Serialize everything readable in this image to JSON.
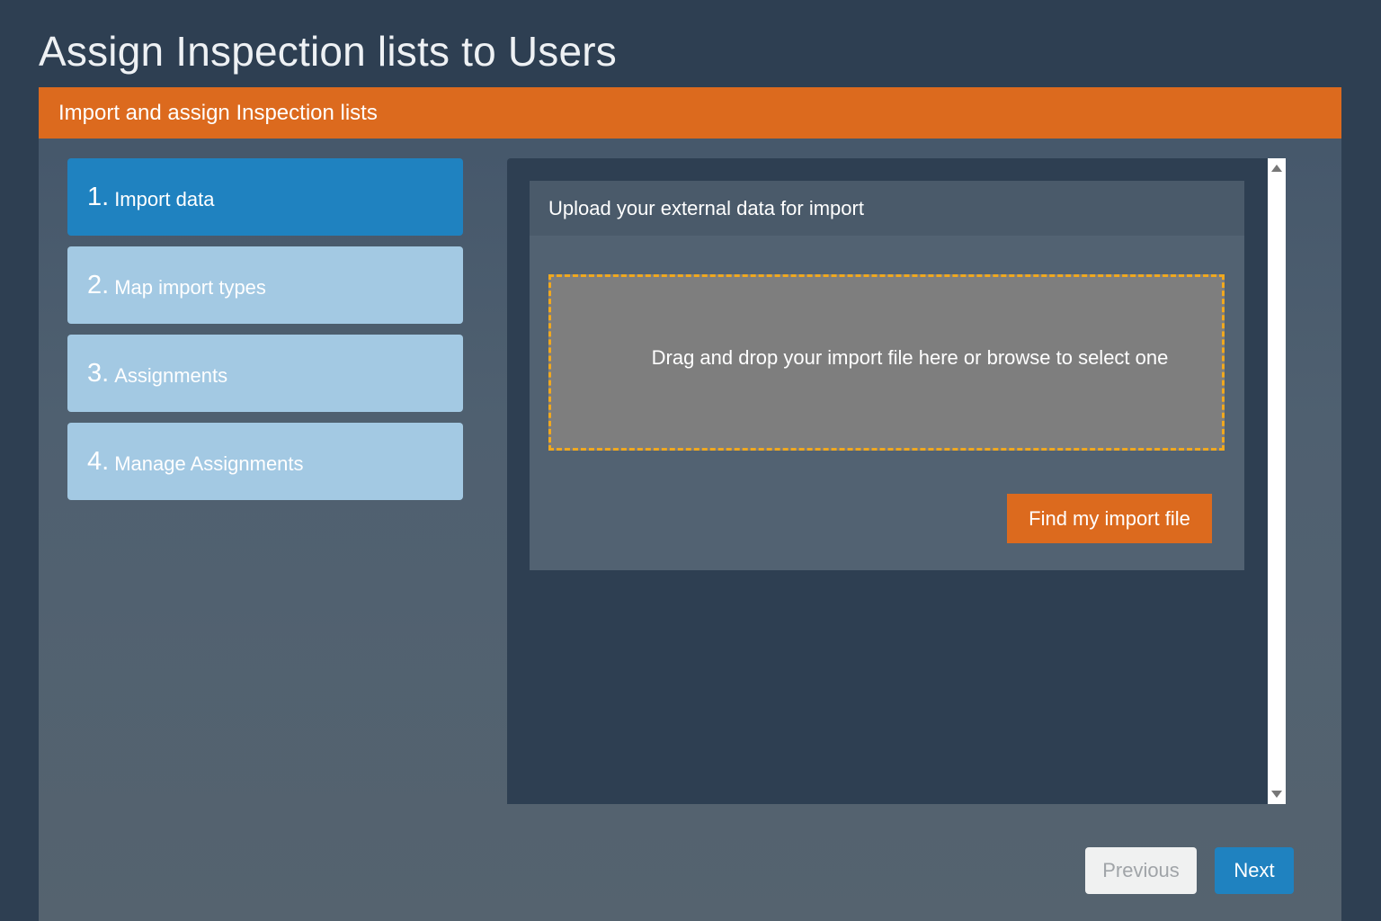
{
  "page": {
    "title": "Assign Inspection lists to Users"
  },
  "panel": {
    "header": "Import and assign Inspection lists"
  },
  "steps": [
    {
      "num": "1.",
      "label": "Import data",
      "active": true
    },
    {
      "num": "2.",
      "label": "Map import types",
      "active": false
    },
    {
      "num": "3.",
      "label": "Assignments",
      "active": false
    },
    {
      "num": "4.",
      "label": "Manage Assignments",
      "active": false
    }
  ],
  "upload": {
    "header": "Upload your external data for import",
    "dropzone_text": "Drag and drop your import file here or browse to select one",
    "find_button": "Find my import file"
  },
  "nav": {
    "previous": "Previous",
    "next": "Next"
  },
  "colors": {
    "accent_orange": "#dc6a1e",
    "active_blue": "#1f82c0",
    "inactive_step": "#a3c9e3",
    "dropzone_border": "#f0a81e"
  },
  "icons": {
    "scroll_up": "triangle-up",
    "scroll_down": "triangle-down"
  }
}
